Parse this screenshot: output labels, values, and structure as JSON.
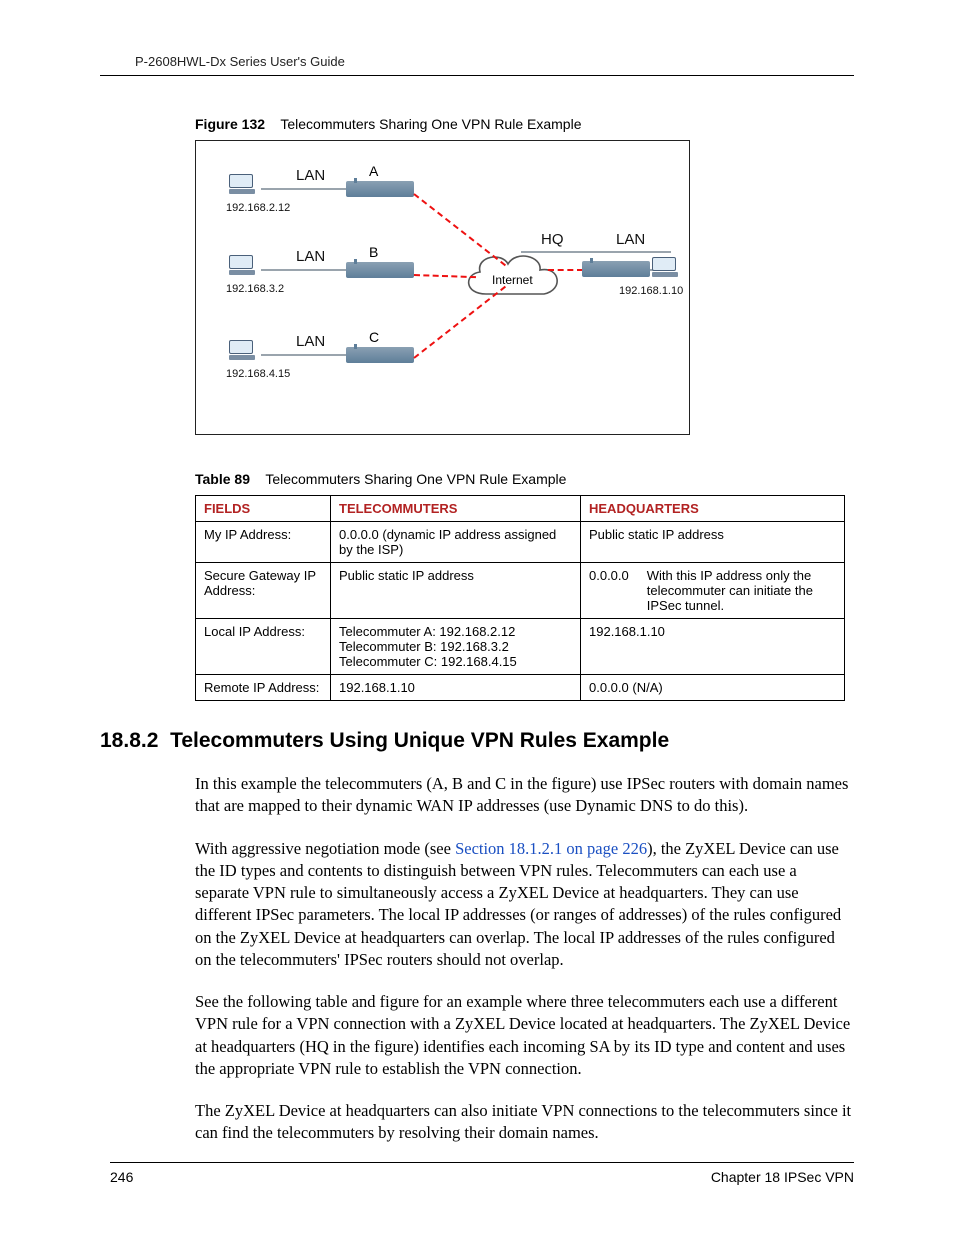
{
  "header": {
    "guide_title": "P-2608HWL-Dx Series User's Guide"
  },
  "figure": {
    "label": "Figure 132",
    "title": "Telecommuters Sharing One VPN Rule Example",
    "lan_label": "LAN",
    "hq_label": "HQ",
    "internet_label": "Internet",
    "letters": {
      "a": "A",
      "b": "B",
      "c": "C"
    },
    "ips": {
      "a": "192.168.2.12",
      "b": "192.168.3.2",
      "c": "192.168.4.15",
      "hq": "192.168.1.10"
    }
  },
  "table": {
    "label": "Table 89",
    "title": "Telecommuters Sharing One VPN Rule Example",
    "headers": {
      "fields": "FIELDS",
      "telecommuters": "TELECOMMUTERS",
      "headquarters": "HEADQUARTERS"
    },
    "rows": [
      {
        "field": "My IP Address:",
        "tele": "0.0.0.0 (dynamic IP address assigned by the ISP)",
        "hq": "Public static IP address"
      },
      {
        "field": "Secure Gateway IP Address:",
        "tele": "Public static IP address",
        "hq_ip": "0.0.0.0",
        "hq_note": "With this IP address only the telecommuter can initiate the IPSec tunnel."
      },
      {
        "field": "Local IP Address:",
        "tele_lines": [
          "Telecommuter A: 192.168.2.12",
          "Telecommuter B: 192.168.3.2",
          "Telecommuter C: 192.168.4.15"
        ],
        "hq": "192.168.1.10"
      },
      {
        "field": "Remote IP Address:",
        "tele": "192.168.1.10",
        "hq": "0.0.0.0 (N/A)"
      }
    ]
  },
  "section": {
    "number": "18.8.2",
    "title": "Telecommuters Using Unique VPN Rules Example"
  },
  "paragraphs": {
    "p1": "In this example the telecommuters (A, B and C in the figure) use IPSec routers with domain names that are mapped to their dynamic WAN IP addresses (use Dynamic DNS to do this).",
    "p2_before": "With aggressive negotiation mode (see ",
    "p2_link": "Section 18.1.2.1 on page 226",
    "p2_after": "), the ZyXEL Device can use the ID types and contents to distinguish between VPN rules. Telecommuters can each use a separate VPN rule to simultaneously access a ZyXEL Device at headquarters. They can use different IPSec parameters. The local IP addresses (or ranges of addresses) of the rules configured on the ZyXEL Device at headquarters can overlap. The local IP addresses of the rules configured on the telecommuters' IPSec routers should not overlap.",
    "p3": "See the following table and figure for an example where three telecommuters each use a different VPN rule for a VPN connection with a ZyXEL Device located at headquarters. The ZyXEL Device at headquarters (HQ in the figure) identifies each incoming SA by its ID type and content and uses the appropriate VPN rule to establish the VPN connection.",
    "p4": "The ZyXEL Device at headquarters can also initiate VPN connections to the telecommuters since it can find the telecommuters by resolving their domain names."
  },
  "footer": {
    "page": "246",
    "chapter": "Chapter 18 IPSec VPN"
  }
}
